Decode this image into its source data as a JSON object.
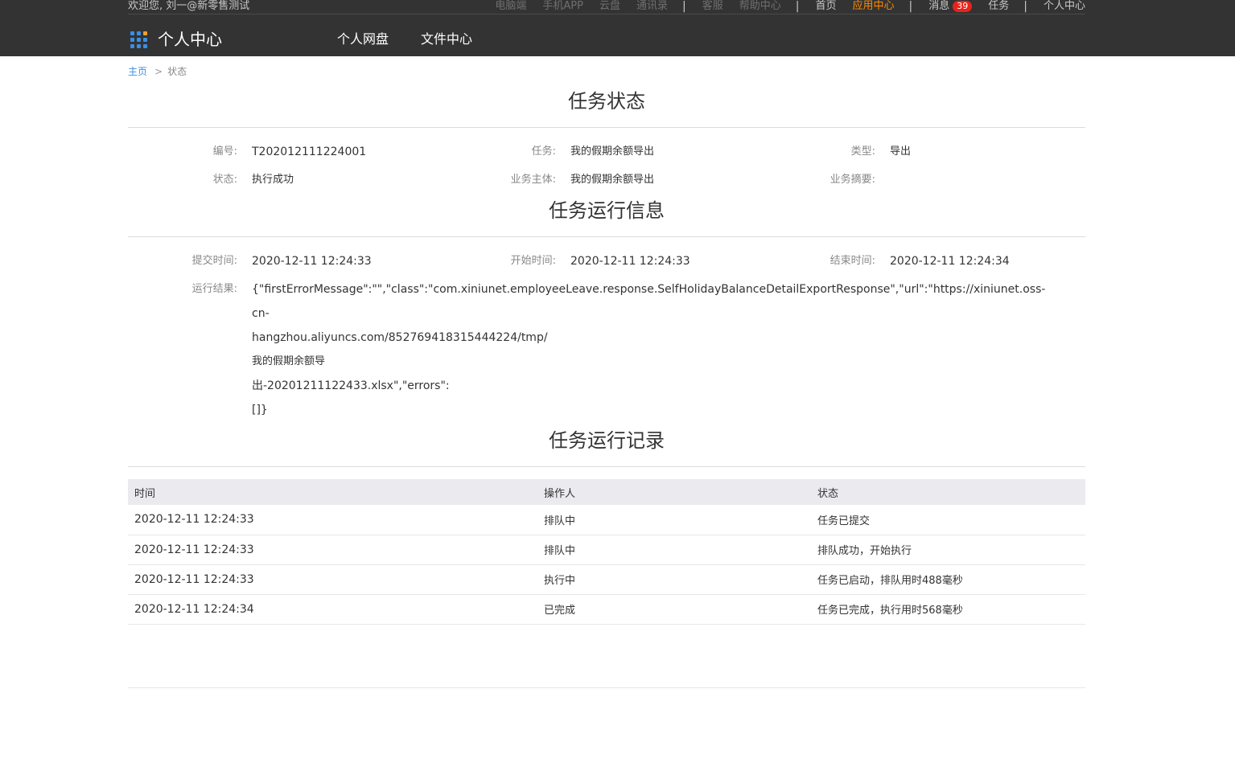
{
  "header": {
    "welcome": "欢迎您, 刘一@新零售测试",
    "top_links": {
      "desktop": "电脑端",
      "mobile_app": "手机APP",
      "cloud": "云盘",
      "contacts": "通讯录",
      "service": "客服",
      "help": "帮助中心",
      "home": "首页",
      "app_center": "应用中心",
      "messages": "消息",
      "messages_count": "39",
      "tasks": "任务",
      "personal_center": "个人中心",
      "separator": "|"
    },
    "logo_text": "个人中心",
    "nav": [
      "个人网盘",
      "文件中心"
    ]
  },
  "breadcrumb": {
    "home": "主页",
    "arrow": ">",
    "current": "状态"
  },
  "task_status": {
    "title": "任务状态",
    "id_label": "编号:",
    "id_value": "T202012111224001",
    "task_label": "任务:",
    "task_value": "我的假期余额导出",
    "type_label": "类型:",
    "type_value": "导出",
    "status_label": "状态:",
    "status_value": "执行成功",
    "subject_label": "业务主体:",
    "subject_value": "我的假期余额导出",
    "summary_label": "业务摘要:",
    "summary_value": ""
  },
  "run_info": {
    "title": "任务运行信息",
    "submit_label": "提交时间:",
    "submit_value": "2020-12-11 12:24:33",
    "start_label": "开始时间:",
    "start_value": "2020-12-11 12:24:33",
    "end_label": "结束时间:",
    "end_value": "2020-12-11 12:24:34",
    "result_label": "运行结果:",
    "result_lines": [
      "{\"firstErrorMessage\":\"\",\"class\":\"com.xiniunet.employeeLeave.response.SelfHolidayBalanceDetailExportResponse\",\"url\":\"https://xiniunet.oss-",
      "cn-",
      "hangzhou.aliyuncs.com/852769418315444224/tmp/",
      "我的假期余额导",
      "出-20201211122433.xlsx\",\"errors\":",
      "[]}"
    ]
  },
  "run_log": {
    "title": "任务运行记录",
    "columns": [
      "时间",
      "操作人",
      "状态"
    ],
    "rows": [
      [
        "2020-12-11 12:24:33",
        "排队中",
        "任务已提交"
      ],
      [
        "2020-12-11 12:24:33",
        "排队中",
        "排队成功，开始执行"
      ],
      [
        "2020-12-11 12:24:33",
        "执行中",
        "任务已启动，排队用时488毫秒"
      ],
      [
        "2020-12-11 12:24:34",
        "已完成",
        "任务已完成，执行用时568毫秒"
      ]
    ]
  }
}
